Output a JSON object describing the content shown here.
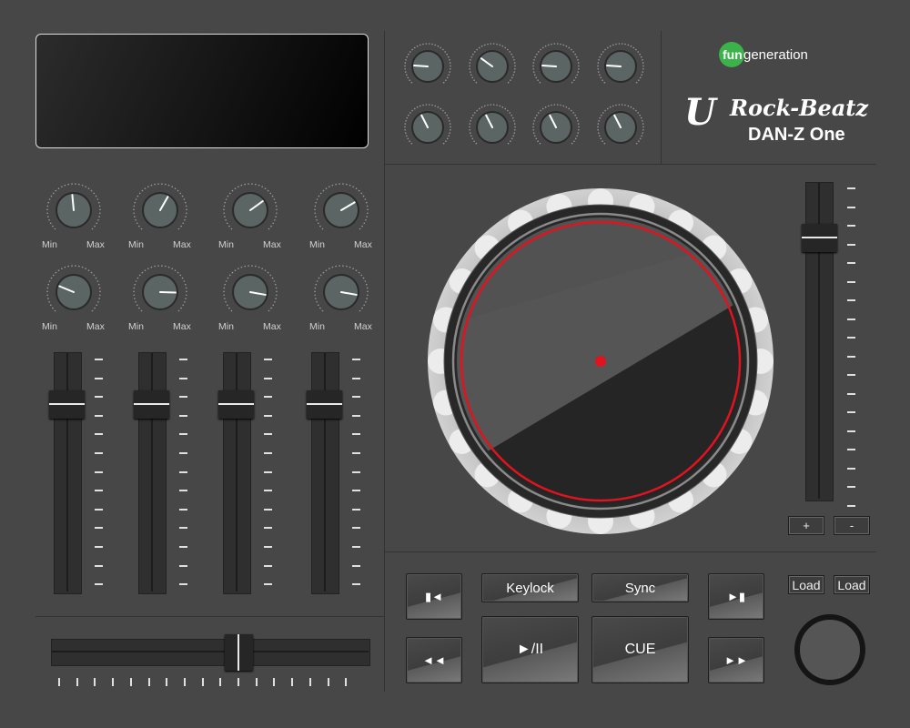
{
  "brand": {
    "logo_prefix": "fun",
    "logo_suffix": "generation",
    "product_u": "U",
    "product_name": "Rock-Beatz",
    "model": "DAN-Z One"
  },
  "knob_labels": {
    "min": "Min",
    "max": "Max"
  },
  "mixer_knobs": [
    {
      "row": 0,
      "col": 0,
      "value": 0.48
    },
    {
      "row": 0,
      "col": 1,
      "value": 0.61
    },
    {
      "row": 0,
      "col": 2,
      "value": 0.7
    },
    {
      "row": 0,
      "col": 3,
      "value": 0.72
    },
    {
      "row": 1,
      "col": 0,
      "value": 0.25
    },
    {
      "row": 1,
      "col": 1,
      "value": 0.84
    },
    {
      "row": 1,
      "col": 2,
      "value": 0.87
    },
    {
      "row": 1,
      "col": 3,
      "value": 0.87
    }
  ],
  "fx_knobs": [
    {
      "value": 0.18
    },
    {
      "value": 0.3
    },
    {
      "value": 0.18
    },
    {
      "value": 0.18
    },
    {
      "value": 0.4
    },
    {
      "value": 0.4
    },
    {
      "value": 0.4
    },
    {
      "value": 0.4
    }
  ],
  "channel_faders": [
    {
      "level": 0.82
    },
    {
      "level": 0.82
    },
    {
      "level": 0.82
    },
    {
      "level": 0.82
    }
  ],
  "crossfader": {
    "position": 0.6
  },
  "pitch_fader": {
    "level": 0.85
  },
  "pitch_buttons": {
    "plus": "+",
    "minus": "-"
  },
  "transport": {
    "keylock": "Keylock",
    "sync": "Sync",
    "play_pause": "►/II",
    "cue": "CUE",
    "prev_track": "▮◄",
    "next_track": "►▮",
    "rewind": "◄◄",
    "fast_forward": "►►"
  },
  "load_buttons": [
    "Load",
    "Load"
  ],
  "colors": {
    "body": "#474747",
    "accent_red": "#e0141e",
    "brand_green": "#3bb34a"
  }
}
